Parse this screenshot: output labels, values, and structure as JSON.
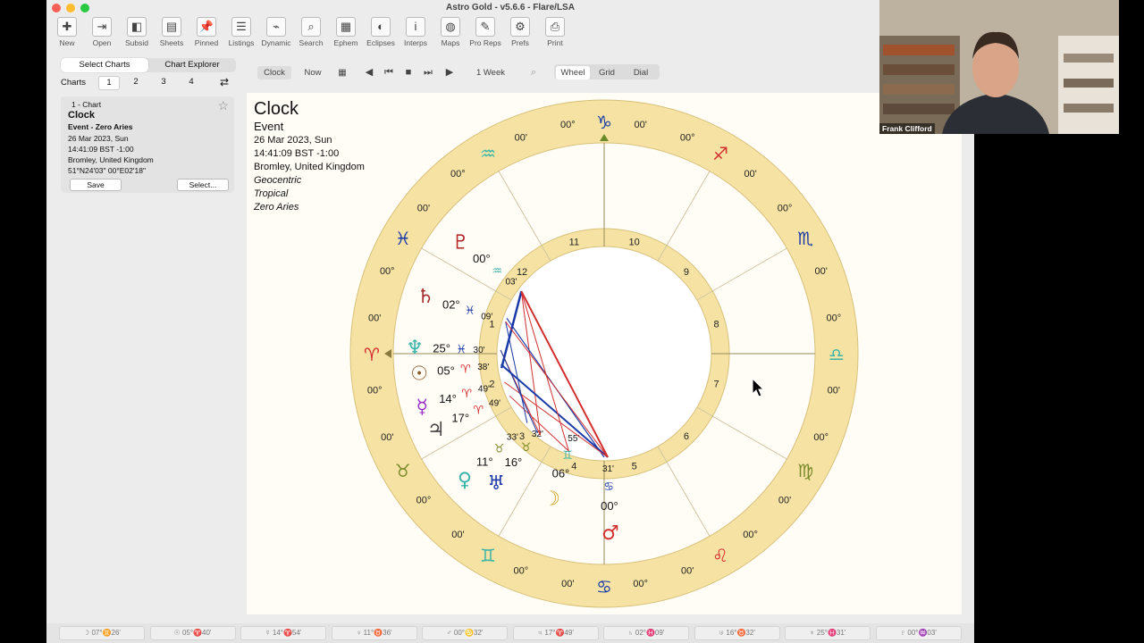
{
  "window": {
    "title": "Astro Gold - v5.6.6 - Flare/LSA"
  },
  "toolbar": [
    {
      "label": "New",
      "icon": "new-chart-icon"
    },
    {
      "label": "Open",
      "icon": "open-icon"
    },
    {
      "label": "Subsid",
      "icon": "subsid-icon"
    },
    {
      "label": "Sheets",
      "icon": "sheets-icon"
    },
    {
      "label": "Pinned",
      "icon": "pin-icon"
    },
    {
      "label": "Listings",
      "icon": "listings-icon"
    },
    {
      "label": "Dynamic",
      "icon": "dynamic-icon"
    },
    {
      "label": "Search",
      "icon": "search-icon"
    },
    {
      "label": "Ephem",
      "icon": "ephemeris-icon"
    },
    {
      "label": "Eclipses",
      "icon": "eclipse-icon"
    },
    {
      "label": "Interps",
      "icon": "info-icon"
    },
    {
      "label": "Maps",
      "icon": "globe-icon"
    },
    {
      "label": "Pro Reps",
      "icon": "feather-icon"
    },
    {
      "label": "Prefs",
      "icon": "gear-icon"
    },
    {
      "label": "Print",
      "icon": "printer-icon"
    }
  ],
  "sidebar": {
    "tabs": [
      "Select Charts",
      "Chart Explorer"
    ],
    "charts_label": "Charts",
    "chart_numbers": [
      "1",
      "2",
      "3",
      "4"
    ],
    "card": {
      "slot": "1 - Chart",
      "name": "Clock",
      "type": "Event - Zero Aries",
      "date": "26 Mar 2023, Sun",
      "time": "14:41:09 BST -1:00",
      "place": "Bromley, United Kingdom",
      "coords": "51°N24'03\" 00°E02'18\"",
      "save": "Save",
      "select": "Select..."
    }
  },
  "nav": {
    "clock": "Clock",
    "now": "Now",
    "step": "1 Week",
    "views": [
      "Wheel",
      "Grid",
      "Dial"
    ]
  },
  "chart_info": {
    "title": "Clock",
    "event": "Event",
    "date": "26 Mar 2023, Sun",
    "time": "14:41:09 BST -1:00",
    "place": "Bromley, United Kingdom",
    "geo": "Geocentric",
    "zodiac": "Tropical",
    "house": "Zero Aries"
  },
  "wheel": {
    "cusps": [
      {
        "sign": "♑",
        "deg": "00°",
        "min": "00'"
      },
      {
        "sign": "♐",
        "deg": "00°",
        "min": "00'"
      },
      {
        "sign": "♏",
        "deg": "00°",
        "min": "00'"
      },
      {
        "sign": "♎",
        "deg": "00°",
        "min": "00'"
      },
      {
        "sign": "♍",
        "deg": "00°",
        "min": "00'"
      },
      {
        "sign": "♌",
        "deg": "00°",
        "min": "00'"
      },
      {
        "sign": "♋",
        "deg": "00°",
        "min": "00'"
      },
      {
        "sign": "♊",
        "deg": "00°",
        "min": "00'"
      },
      {
        "sign": "♉",
        "deg": "00°",
        "min": "00'"
      },
      {
        "sign": "♈",
        "deg": "00°",
        "min": "00'"
      },
      {
        "sign": "♓",
        "deg": "00°",
        "min": "00'"
      },
      {
        "sign": "♒",
        "deg": "00°",
        "min": "00'"
      }
    ],
    "house_numbers": [
      "10",
      "9",
      "8",
      "7",
      "6",
      "5",
      "4",
      "3",
      "2",
      "1",
      "12",
      "11"
    ],
    "planets": [
      {
        "glyph": "♇",
        "deg": "00°",
        "sign": "♒",
        "min": "03'"
      },
      {
        "glyph": "♄",
        "deg": "02°",
        "sign": "♓",
        "min": "09'"
      },
      {
        "glyph": "♆",
        "deg": "25°",
        "sign": "♓",
        "min": "30'"
      },
      {
        "glyph": "☉",
        "deg": "05°",
        "sign": "♈",
        "min": "38'"
      },
      {
        "glyph": "☿",
        "deg": "14°",
        "sign": "♈",
        "min": "49'"
      },
      {
        "glyph": "♃",
        "deg": "17°",
        "sign": "♈",
        "min": "49'"
      },
      {
        "glyph": "♀",
        "deg": "11°",
        "sign": "♉",
        "min": "33'"
      },
      {
        "glyph": "♅",
        "deg": "16°",
        "sign": "♉",
        "min": "32'"
      },
      {
        "glyph": "☽",
        "deg": "06°",
        "sign": "♊",
        "min": "55'"
      },
      {
        "glyph": "♂",
        "deg": "00°",
        "sign": "♋",
        "min": "31'"
      }
    ]
  },
  "status_bar": [
    "☽ 07°♊26'",
    "☉ 05°♈40'",
    "☿ 14°♈54'",
    "♀ 11°♉36'",
    "♂ 00°♋32'",
    "♃ 17°♈49'",
    "♄ 02°♓09'",
    "♅ 16°♉32'",
    "♆ 25°♓31'",
    "♇ 00°♒03'"
  ],
  "video": {
    "name": "Frank Clifford"
  }
}
